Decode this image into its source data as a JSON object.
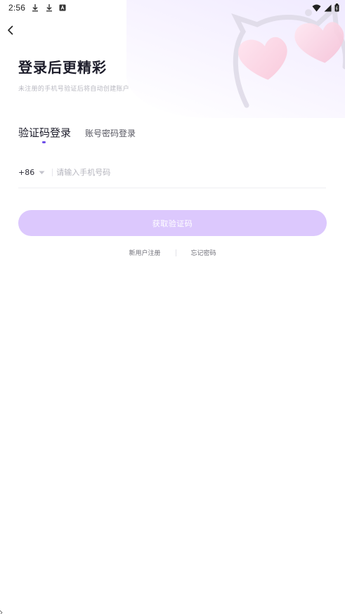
{
  "status_bar": {
    "time": "2:56",
    "left_icons": [
      "download-icon",
      "download-icon",
      "font-a-icon"
    ],
    "right_icons": [
      "wifi-icon",
      "signal-icon",
      "battery-icon"
    ]
  },
  "header": {
    "title": "登录后更精彩",
    "subtitle": "未注册的手机号验证后将自动创建账户"
  },
  "tabs": [
    {
      "label": "验证码登录",
      "active": true
    },
    {
      "label": "账号密码登录",
      "active": false
    }
  ],
  "phone": {
    "country_code": "+86",
    "placeholder": "请输入手机号码",
    "value": ""
  },
  "primary_button": {
    "label": "获取验证码",
    "color": "#dcc8fd"
  },
  "links": {
    "register": "新用户注册",
    "forgot_password": "忘记密码"
  },
  "colors": {
    "accent": "#6d4de8",
    "title": "#1c1c2a",
    "hero_bg": "#efe9ff"
  }
}
